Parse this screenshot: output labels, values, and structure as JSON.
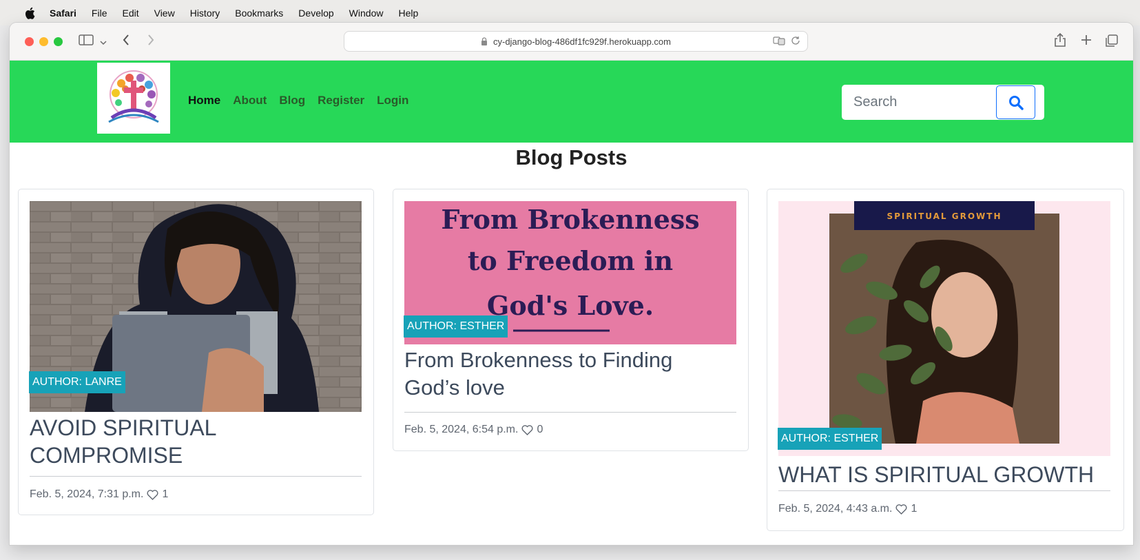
{
  "menubar": {
    "app": "Safari",
    "items": [
      "File",
      "Edit",
      "View",
      "History",
      "Bookmarks",
      "Develop",
      "Window",
      "Help"
    ]
  },
  "browser": {
    "url": "cy-django-blog-486df1fc929f.herokuapp.com"
  },
  "nav": {
    "links": [
      {
        "label": "Home",
        "active": true
      },
      {
        "label": "About"
      },
      {
        "label": "Blog"
      },
      {
        "label": "Register"
      },
      {
        "label": "Login"
      }
    ],
    "search_placeholder": "Search"
  },
  "main": {
    "title": "Blog Posts",
    "posts": [
      {
        "author_badge": "AUTHOR: LANRE",
        "title": "AVOID SPIRITUAL COMPROMISE",
        "date": "Feb. 5, 2024, 7:31 p.m.",
        "likes": "1"
      },
      {
        "author_badge": "AUTHOR: ESTHER",
        "image_text": "From Brokenness to Freedom in God's Love.",
        "title": "From Brokenness to Finding God’s love",
        "date": "Feb. 5, 2024, 6:54 p.m.",
        "likes": "0"
      },
      {
        "author_badge": "AUTHOR: ESTHER",
        "image_banner": "SPIRITUAL GROWTH",
        "title": "WHAT IS SPIRITUAL GROWTH",
        "date": "Feb. 5, 2024, 4:43 a.m.",
        "likes": "1"
      }
    ]
  },
  "colors": {
    "nav_bg": "#27d858",
    "badge": "#17a2b8",
    "search_btn_border": "#0d6efd"
  }
}
